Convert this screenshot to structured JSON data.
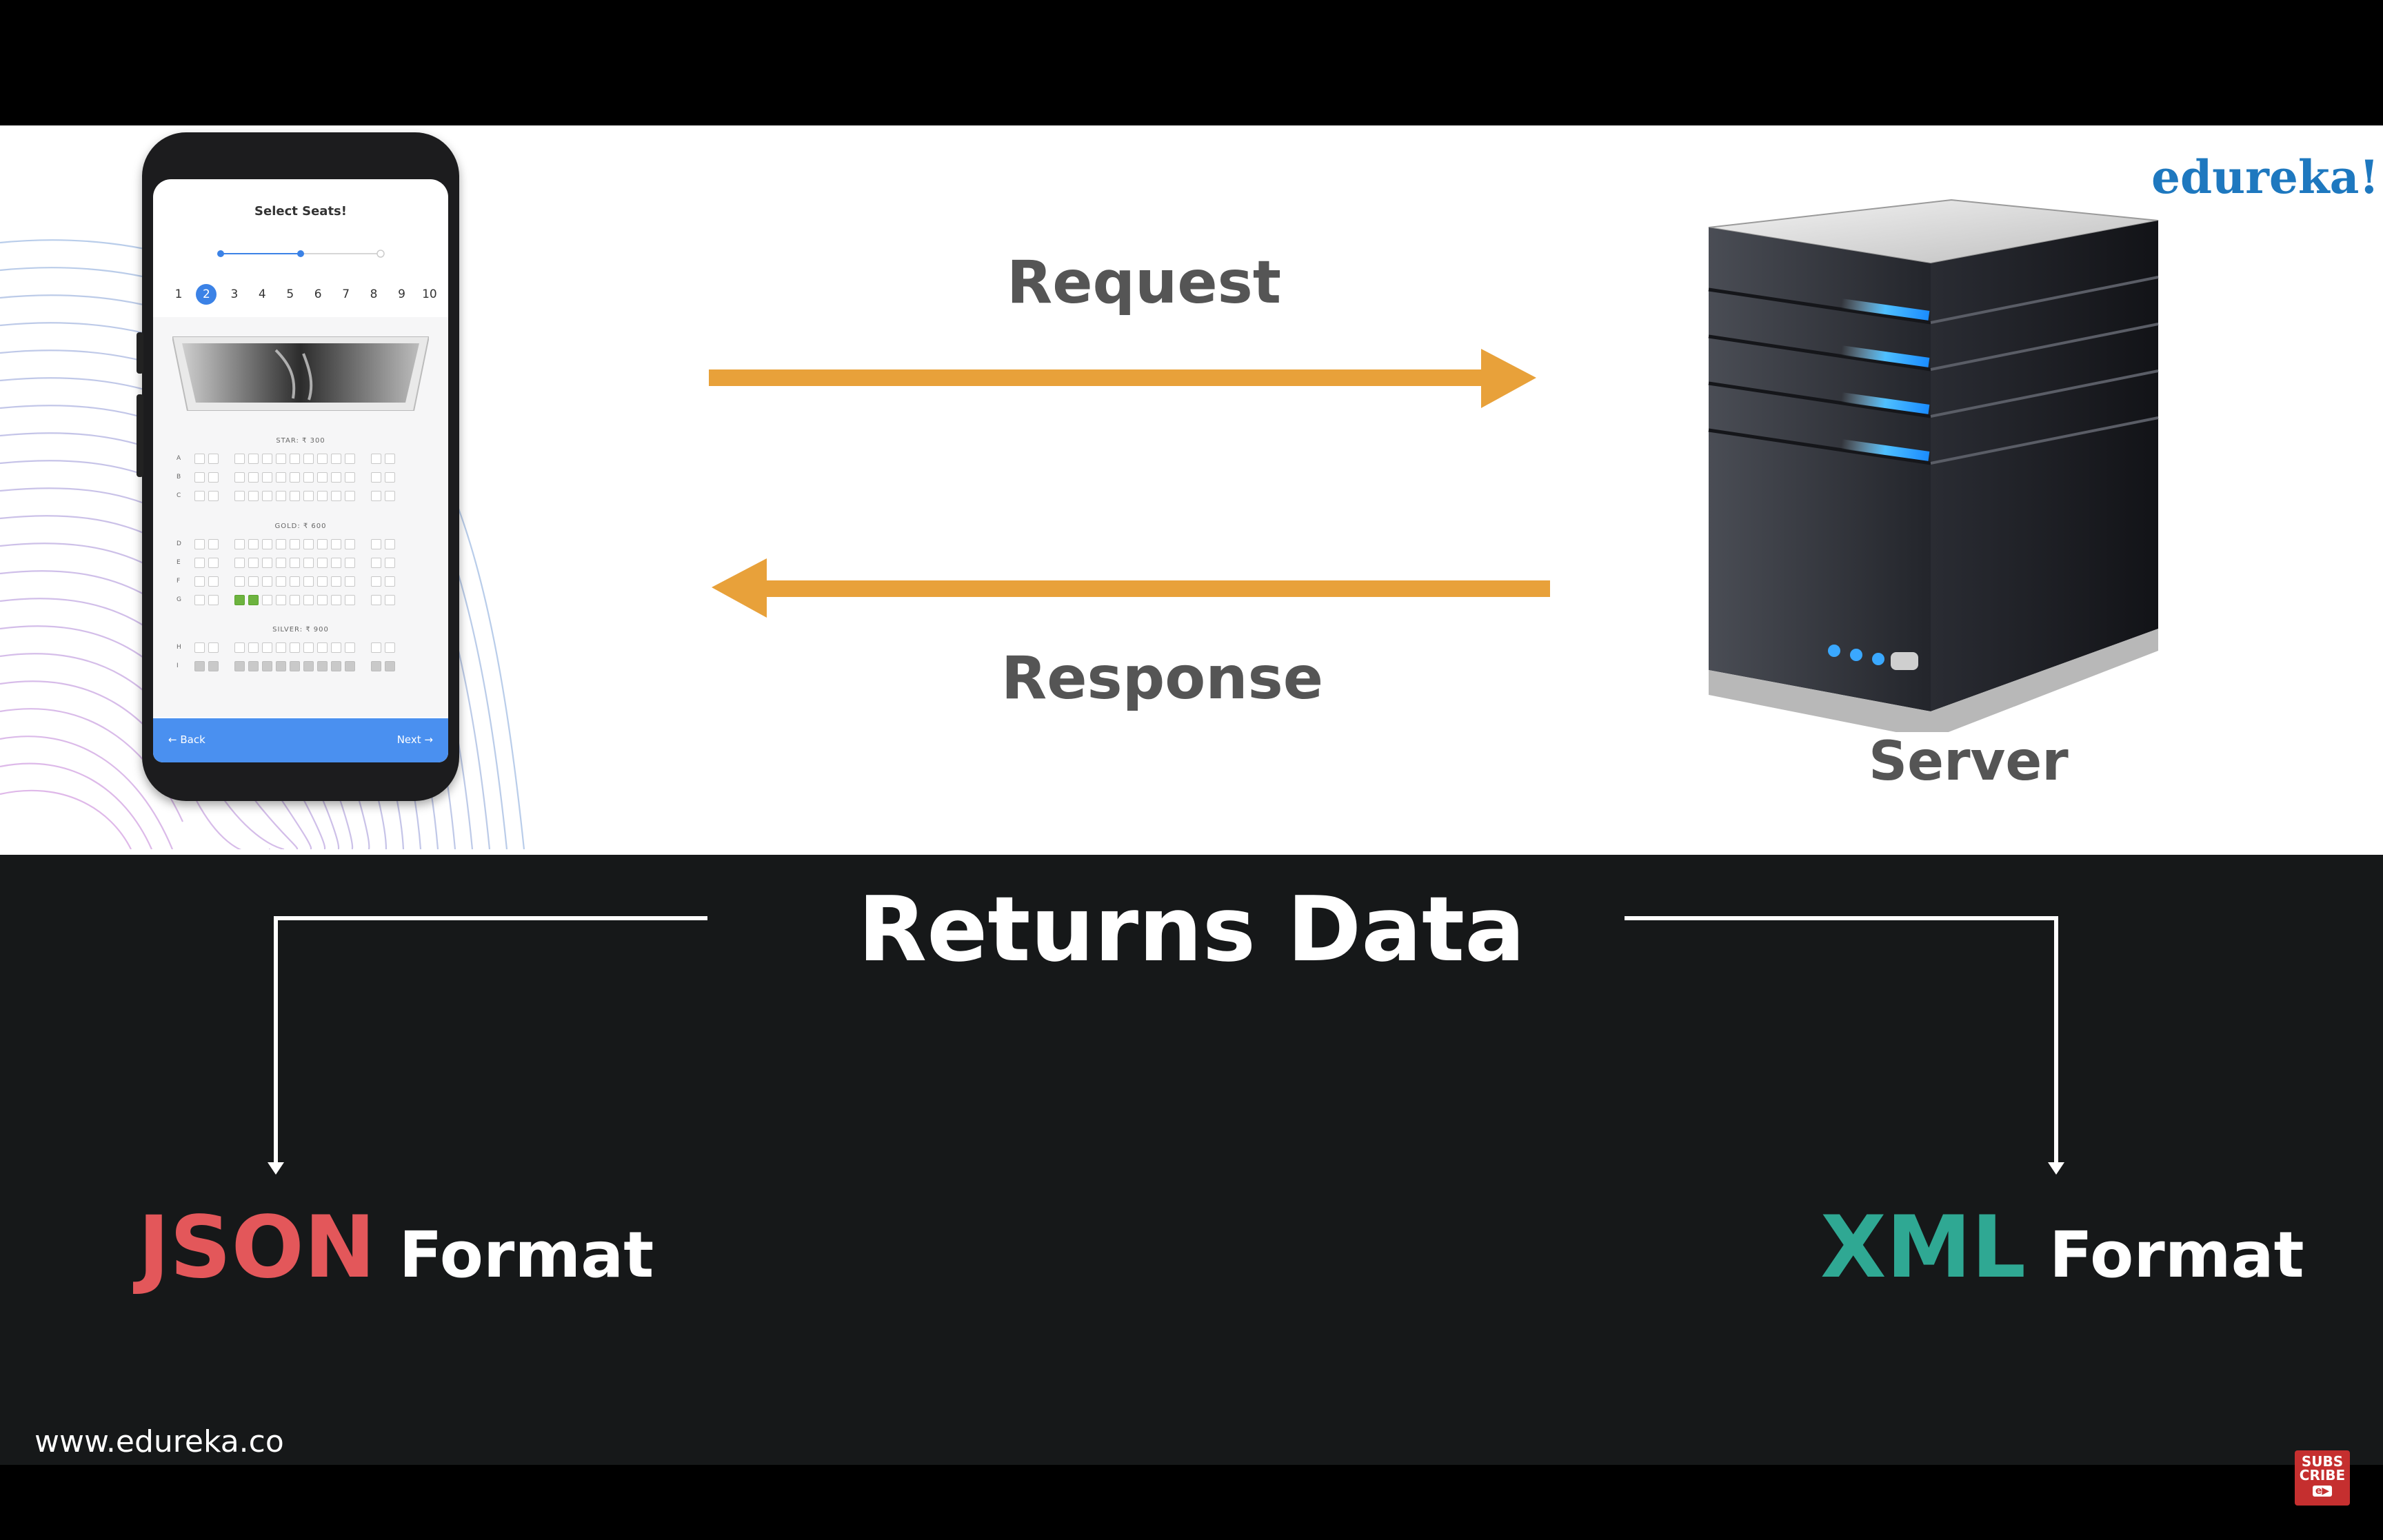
{
  "brand": {
    "logo_text": "edureka!",
    "website": "www.edureka.co"
  },
  "phone": {
    "title": "Select Seats!",
    "steps": [
      "1",
      "2",
      "3",
      "4",
      "5",
      "6",
      "7",
      "8",
      "9",
      "10"
    ],
    "selected_step": "2",
    "categories": [
      "STAR: ₹ 300",
      "GOLD: ₹ 600",
      "SILVER: ₹ 900"
    ],
    "rows": [
      "A",
      "B",
      "C",
      "D",
      "E",
      "F",
      "G",
      "H",
      "I"
    ],
    "back_label": "Back",
    "next_label": "Next"
  },
  "diagram": {
    "request_label": "Request",
    "response_label": "Response",
    "server_label": "Server",
    "returns_label": "Returns Data",
    "json_word": "JSON",
    "xml_word": "XML",
    "format_word": "Format",
    "arrow_color": "#e8a13a",
    "json_color": "#e3575a",
    "xml_color": "#2fa893"
  },
  "subscribe": {
    "line1": "SUBS",
    "line2": "CRIBE",
    "icon": "play-icon"
  }
}
